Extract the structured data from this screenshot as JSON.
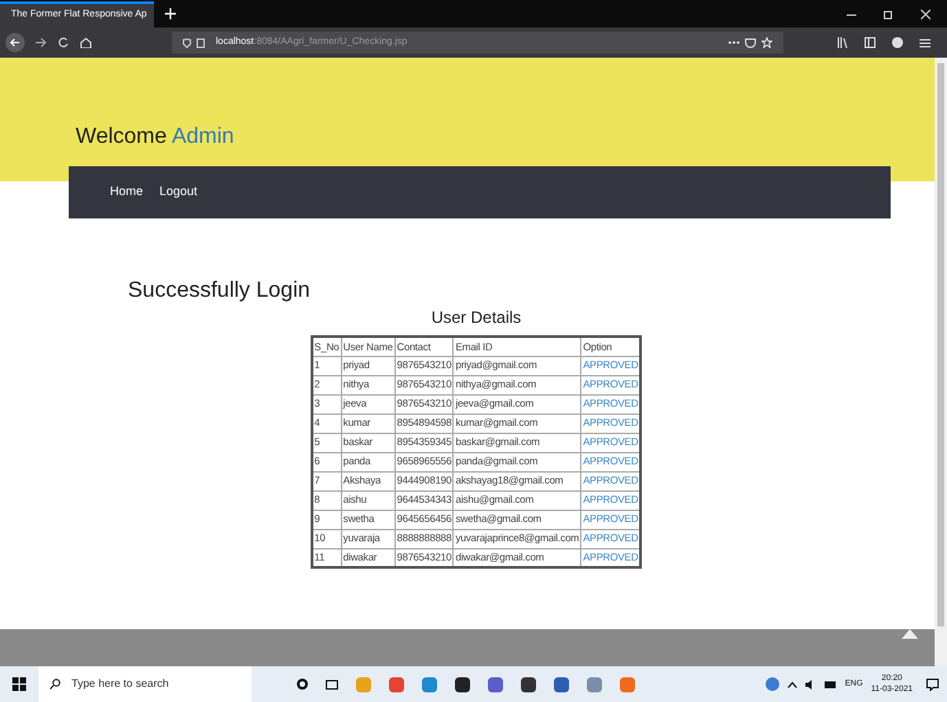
{
  "browser": {
    "tab_title": "The Former Flat Responsive Ap",
    "url_host": "localhost",
    "url_path": ":8084/AAgri_farmer/U_Checking.jsp"
  },
  "header": {
    "welcome": "Welcome",
    "user": "Admin"
  },
  "nav": [
    "Home",
    "Logout"
  ],
  "message": "Successfully Login",
  "table": {
    "title": "User Details",
    "columns": [
      "S_No",
      "User Name",
      "Contact",
      "Email ID",
      "Option"
    ],
    "rows": [
      [
        "1",
        "priyad",
        "9876543210",
        "priyad@gmail.com",
        "APPROVED"
      ],
      [
        "2",
        "nithya",
        "9876543210",
        "nithya@gmail.com",
        "APPROVED"
      ],
      [
        "3",
        "jeeva",
        "9876543210",
        "jeeva@gmail.com",
        "APPROVED"
      ],
      [
        "4",
        "kumar",
        "8954894598",
        "kumar@gmail.com",
        "APPROVED"
      ],
      [
        "5",
        "baskar",
        "8954359345",
        "baskar@gmail.com",
        "APPROVED"
      ],
      [
        "6",
        "panda",
        "9658965556",
        "panda@gmail.com",
        "APPROVED"
      ],
      [
        "7",
        "Akshaya",
        "9444908190",
        "akshayag18@gmail.com",
        "APPROVED"
      ],
      [
        "8",
        "aishu",
        "9644534343",
        "aishu@gmail.com",
        "APPROVED"
      ],
      [
        "9",
        "swetha",
        "9645656456",
        "swetha@gmail.com",
        "APPROVED"
      ],
      [
        "10",
        "yuvaraja",
        "8888888888",
        "yuvarajaprince8@gmail.com",
        "APPROVED"
      ],
      [
        "11",
        "diwakar",
        "9876543210",
        "diwakar@gmail.com",
        "APPROVED"
      ]
    ]
  },
  "taskbar": {
    "search_placeholder": "Type here to search",
    "language": "ENG",
    "time": "20:20",
    "date": "11-03-2021"
  }
}
